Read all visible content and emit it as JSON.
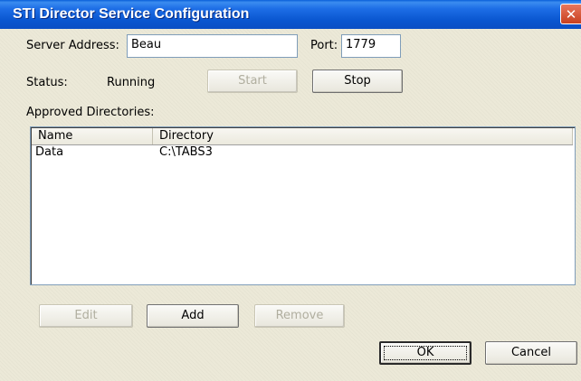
{
  "window": {
    "title": "STI Director Service Configuration",
    "close_glyph": "✕"
  },
  "server": {
    "label": "Server Address:",
    "value": "Beau"
  },
  "port": {
    "label": "Port:",
    "value": "1779"
  },
  "status": {
    "label": "Status:",
    "value": "Running"
  },
  "buttons": {
    "start": "Start",
    "stop": "Stop",
    "edit": "Edit",
    "add": "Add",
    "remove": "Remove",
    "ok": "OK",
    "cancel": "Cancel"
  },
  "directories": {
    "label": "Approved Directories:",
    "columns": [
      "Name",
      "Directory"
    ],
    "rows": [
      {
        "name": "Data",
        "directory": "C:\\TABS3"
      }
    ]
  },
  "colors": {
    "titlebar": "#0a56d0",
    "dialog_bg": "#ece9d8",
    "close": "#c8401f"
  },
  "icons": {
    "close": "close-icon"
  }
}
